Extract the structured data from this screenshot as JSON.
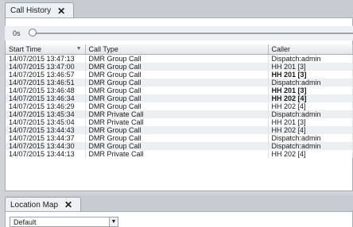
{
  "call_history_tab": {
    "label": "Call History",
    "close_icon": "✕"
  },
  "slider": {
    "label": "0s"
  },
  "table": {
    "headers": [
      "Start Time",
      "Call Type",
      "Caller"
    ],
    "rows": [
      [
        "14/07/2015 13:47:13",
        "DMR Group Call",
        "Dispatch:admin",
        false
      ],
      [
        "14/07/2015 13:47:00",
        "DMR Group Call",
        "HH 201 [3]",
        false
      ],
      [
        "14/07/2015 13:46:57",
        "DMR Group Call",
        "HH 201 [3]",
        true
      ],
      [
        "14/07/2015 13:46:51",
        "DMR Group Call",
        "Dispatch:admin",
        false
      ],
      [
        "14/07/2015 13:46:48",
        "DMR Group Call",
        "HH 201 [3]",
        true
      ],
      [
        "14/07/2015 13:46:34",
        "DMR Group Call",
        "HH 202 [4]",
        true
      ],
      [
        "14/07/2015 13:46:29",
        "DMR Group Call",
        "HH 202 [4]",
        false
      ],
      [
        "14/07/2015 13:45:34",
        "DMR Private Call",
        "Dispatch:admin",
        false
      ],
      [
        "14/07/2015 13:45:04",
        "DMR Private Call",
        "HH 201 [3]",
        false
      ],
      [
        "14/07/2015 13:44:43",
        "DMR Group Call",
        "HH 202 [4]",
        false
      ],
      [
        "14/07/2015 13:44:37",
        "DMR Group Call",
        "Dispatch:admin",
        false
      ],
      [
        "14/07/2015 13:44:30",
        "DMR Group Call",
        "Dispatch:admin",
        false
      ],
      [
        "14/07/2015 13:44:13",
        "DMR Private Call",
        "HH 202 [4]",
        false
      ]
    ]
  },
  "location_map_tab": {
    "label": "Location Map",
    "close_icon": "✕"
  },
  "map_layer_dropdown": {
    "value": "Default",
    "arrow_icon": "▼"
  }
}
